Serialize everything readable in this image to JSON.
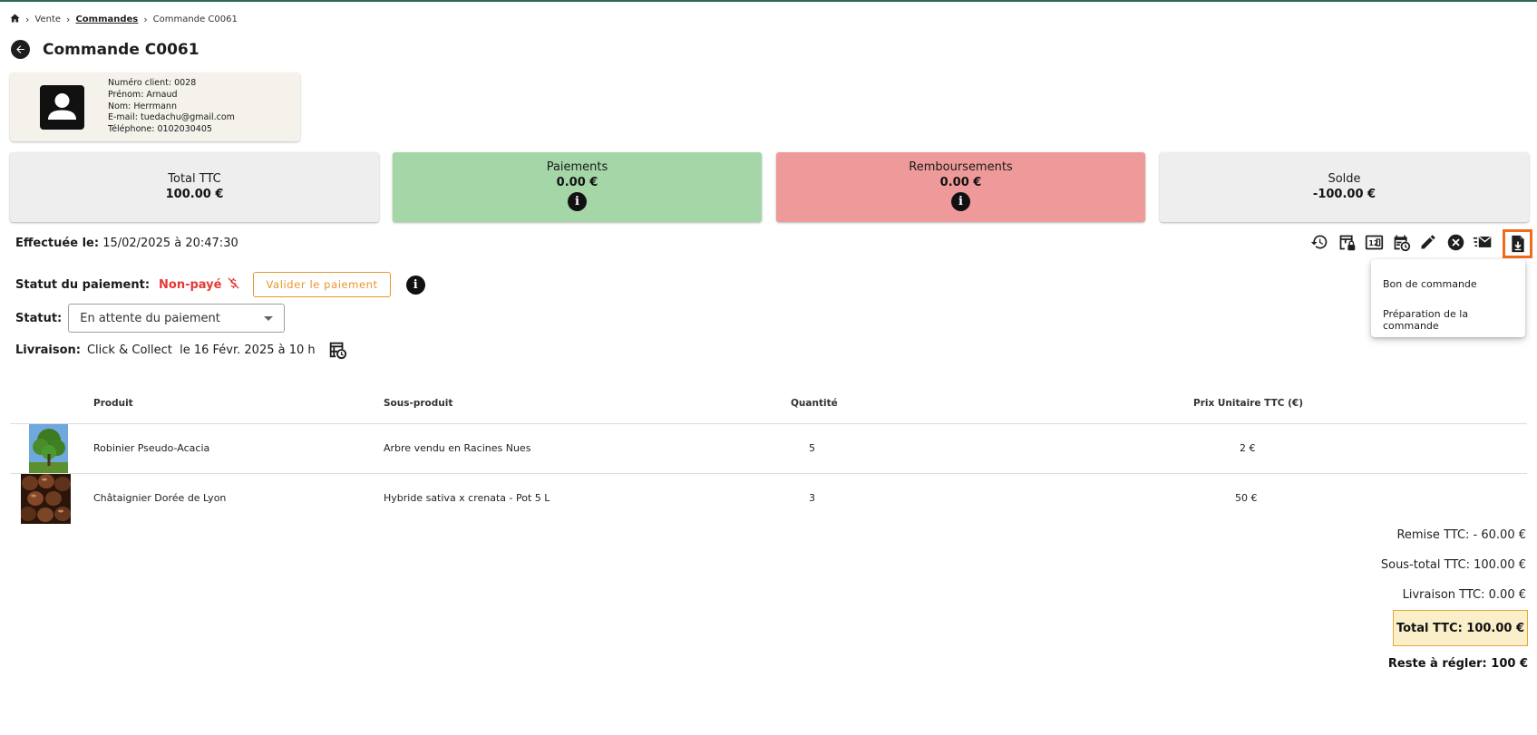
{
  "breadcrumb": {
    "items": [
      "Vente",
      "Commandes",
      "Commande C0061"
    ]
  },
  "page_title": "Commande C0061",
  "client": {
    "numero": "Numéro client: 0028",
    "prenom": "Prénom: Arnaud",
    "nom": "Nom: Herrmann",
    "email": "E-mail: tuedachu@gmail.com",
    "telephone": "Téléphone: 0102030405"
  },
  "summary": {
    "total": {
      "label": "Total TTC",
      "value": "100.00 €",
      "color": "#eeeeee"
    },
    "paiements": {
      "label": "Paiements",
      "value": "0.00 €",
      "color": "#a5d6a7"
    },
    "remboursements": {
      "label": "Remboursements",
      "value": "0.00 €",
      "color": "#ef9a9a"
    },
    "solde": {
      "label": "Solde",
      "value": "-100.00 €",
      "color": "#eeeeee"
    }
  },
  "order": {
    "effectuee_label": "Effectuée le:",
    "effectuee_value": "15/02/2025 à 20:47:30",
    "statut_paiement_label": "Statut du paiement:",
    "statut_paiement_value": "Non-payé",
    "valider_label": "Valider le paiement",
    "statut_label": "Statut:",
    "statut_value": "En attente du paiement",
    "livraison_label": "Livraison:",
    "livraison_value": "Click & Collect  le 16 Févr. 2025 à 10 h"
  },
  "toolbar": {
    "icons": [
      "history-icon",
      "table-lock-icon",
      "numeric-calendar-icon",
      "calendar-clock-icon",
      "edit-icon",
      "cancel-icon",
      "email-list-icon",
      "file-download-icon"
    ],
    "accent": "#f26a1b"
  },
  "download_menu": {
    "items": [
      "Bon de commande",
      "Préparation de la commande"
    ]
  },
  "table": {
    "headers": [
      "Produit",
      "Sous-produit",
      "Quantité",
      "Prix Unitaire TTC (€)"
    ],
    "rows": [
      {
        "produit": "Robinier Pseudo-Acacia",
        "sous_produit": "Arbre vendu en Racines Nues",
        "quantite": "5",
        "prix": "2 €"
      },
      {
        "produit": "Châtaignier Dorée de Lyon",
        "sous_produit": "Hybride sativa x crenata - Pot 5 L",
        "quantite": "3",
        "prix": "50 €"
      }
    ]
  },
  "totals": {
    "remise": "Remise TTC: - 60.00 €",
    "sous_total": "Sous-total TTC: 100.00 €",
    "livraison": "Livraison TTC: 0.00 €",
    "total": "Total TTC: 100.00 €",
    "reste": "Reste à régler: 100 €"
  }
}
